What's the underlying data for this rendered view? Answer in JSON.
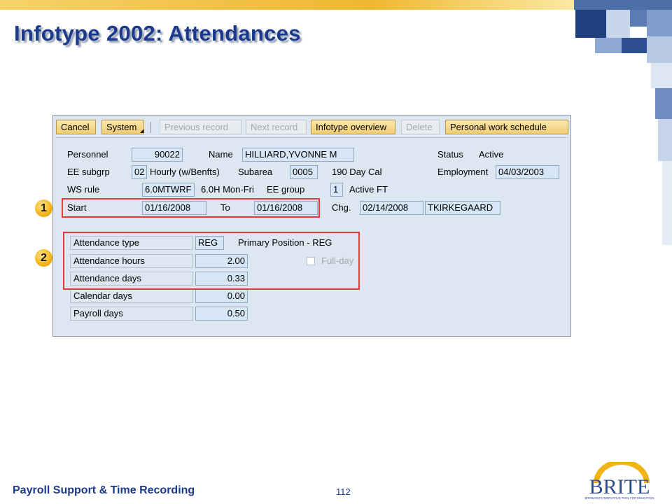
{
  "slide": {
    "title": "Infotype 2002: Attendances",
    "footer_left": "Payroll Support & Time Recording",
    "page_number": "112",
    "logo_text": "BRITE",
    "logo_tagline": "BROWARD'S INNOVATIVE TOOL FOR EDUCATION"
  },
  "toolbar": {
    "cancel": "Cancel",
    "system": "System",
    "previous_record": "Previous record",
    "next_record": "Next record",
    "infotype_overview": "Infotype overview",
    "delete": "Delete",
    "personal_work_schedule": "Personal work schedule"
  },
  "header": {
    "personnel_label": "Personnel",
    "personnel_value": "90022",
    "name_label": "Name",
    "name_value": "HILLIARD,YVONNE M",
    "status_label": "Status",
    "status_value": "Active",
    "ee_subgrp_label": "EE subgrp",
    "ee_subgrp_code": "02",
    "ee_subgrp_text": "Hourly  (w/Benfts)",
    "subarea_label": "Subarea",
    "subarea_value": "0005",
    "subarea_text": "190 Day Cal",
    "employment_label": "Employment",
    "employment_value": "04/03/2003",
    "ws_rule_label": "WS rule",
    "ws_rule_value": "6.0MTWRF",
    "ws_rule_text": "6.0H Mon-Fri",
    "ee_group_label": "EE group",
    "ee_group_value": "1",
    "ee_group_text": "Active FT"
  },
  "period": {
    "start_label": "Start",
    "start_value": "01/16/2008",
    "to_label": "To",
    "to_value": "01/16/2008",
    "chg_label": "Chg.",
    "chg_date": "02/14/2008",
    "chg_user": "TKIRKEGAARD"
  },
  "attendance": {
    "type_label": "Attendance type",
    "type_value": "REG",
    "type_text": "Primary Position - REG",
    "hours_label": "Attendance hours",
    "hours_value": "2.00",
    "fullday_label": "Full-day",
    "days_label": "Attendance days",
    "days_value": "0.33",
    "calendar_label": "Calendar days",
    "calendar_value": "0.00",
    "payroll_label": "Payroll days",
    "payroll_value": "0.50"
  },
  "markers": {
    "m1": "1",
    "m2": "2"
  },
  "colors": {
    "title": "#1b3a8c",
    "highlight": "#e23b3b",
    "accent": "#f2b316"
  }
}
